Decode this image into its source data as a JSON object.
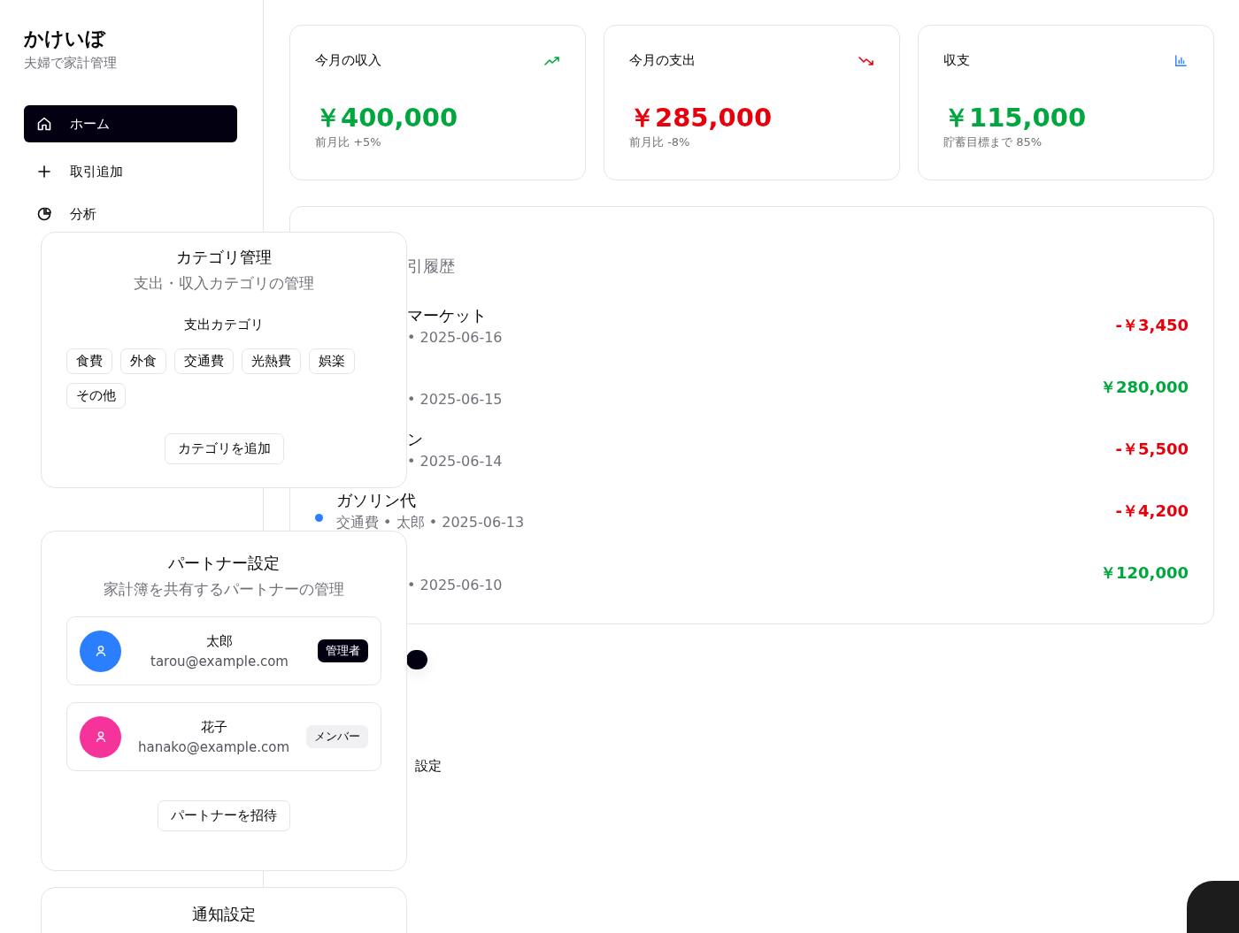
{
  "sidebar": {
    "logo": "かけいぼ",
    "tagline": "夫婦で家計管理",
    "nav": [
      {
        "label": "ホーム",
        "selected": true
      },
      {
        "label": "取引追加",
        "selected": false
      },
      {
        "label": "分析",
        "selected": false
      }
    ]
  },
  "stats": [
    {
      "title": "今月の収入",
      "kind": "positive",
      "value": "￥400,000",
      "note": "前月比 +5%"
    },
    {
      "title": "今月の支出",
      "kind": "negative",
      "value": "￥285,000",
      "note": "前月比 -8%"
    },
    {
      "title": "収支",
      "kind": "balance",
      "value": "￥115,000",
      "note": "貯蓄目標まで 85%"
    }
  ],
  "transactions": {
    "title": "引履歴",
    "rows": [
      {
        "covered": true,
        "name": "マーケット",
        "meta": "• 2025-06-16",
        "amount": "-￥3,450",
        "kind": "expense"
      },
      {
        "covered": true,
        "meta": "• 2025-06-15",
        "amount": "￥280,000",
        "kind": "income"
      },
      {
        "covered": true,
        "name": "ン",
        "meta": "• 2025-06-14",
        "amount": "-￥5,500",
        "kind": "expense"
      },
      {
        "covered": false,
        "name": "ガソリン代",
        "meta": "交通費 • 太郎 • 2025-06-13",
        "amount": "-￥4,200",
        "kind": "expense",
        "color": "#2b7fff"
      },
      {
        "covered": true,
        "meta": "• 2025-06-10",
        "amount": "￥120,000",
        "kind": "income"
      }
    ]
  },
  "lower": {
    "settings_label": "設定"
  },
  "category_panel": {
    "title": "カテゴリ管理",
    "subtitle": "支出・収入カテゴリの管理",
    "section": "支出カテゴリ",
    "chips": [
      "食費",
      "外食",
      "交通費",
      "光熱費",
      "娯楽",
      "その他"
    ],
    "button": "カテゴリを追加"
  },
  "partner_panel": {
    "title": "パートナー設定",
    "subtitle": "家計簿を共有するパートナーの管理",
    "members": [
      {
        "name": "太郎",
        "email": "tarou@example.com",
        "role": "管理者",
        "kind": "admin",
        "color": "#2b7fff"
      },
      {
        "name": "花子",
        "email": "hanako@example.com",
        "role": "メンバー",
        "kind": "member",
        "color": "#f6339a"
      }
    ],
    "button": "パートナーを招待"
  },
  "notification_panel": {
    "title": "通知設定"
  }
}
